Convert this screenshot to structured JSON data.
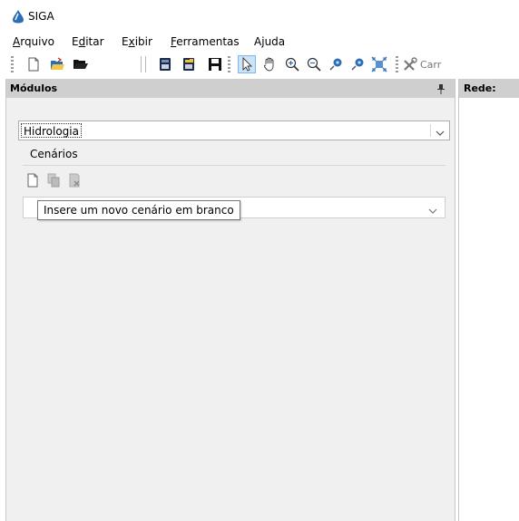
{
  "window": {
    "title": "SIGA",
    "icon": "water-drop-icon"
  },
  "menu": {
    "items": [
      {
        "label": "Arquivo",
        "mnemonic_index": 0
      },
      {
        "label": "Editar",
        "mnemonic_index": 1
      },
      {
        "label": "Exibir",
        "mnemonic_index": 1
      },
      {
        "label": "Ferramentas",
        "mnemonic_index": 0
      },
      {
        "label": "Ajuda",
        "mnemonic_index": 1
      }
    ]
  },
  "toolbar": {
    "buttons": [
      "new-file-icon",
      "open-file-icon",
      "open-folder-icon",
      "database-icon",
      "edit-database-icon",
      "save-icon",
      "select-arrow-icon",
      "pan-hand-icon",
      "zoom-in-icon",
      "zoom-out-icon",
      "map-pin-icon",
      "map-pin-2-icon",
      "fit-extent-icon",
      "tools-icon"
    ],
    "selected": "select-arrow-icon",
    "truncated_text": "Carr"
  },
  "modules_pane": {
    "title": "Módulos",
    "module_select": {
      "value": "Hidrologia"
    },
    "scenarios_group": {
      "label": "Cenários",
      "buttons": [
        "new-scenario-icon",
        "copy-scenario-icon",
        "delete-scenario-icon"
      ],
      "scenario_select": {
        "value": ""
      }
    },
    "tooltip": "Insere um novo cenário em branco"
  },
  "network_pane": {
    "title": "Rede:"
  },
  "colors": {
    "pane_header": "#cfcfcf",
    "pane_background": "#f0f0f0",
    "selected_tool": "#cce4f7"
  }
}
